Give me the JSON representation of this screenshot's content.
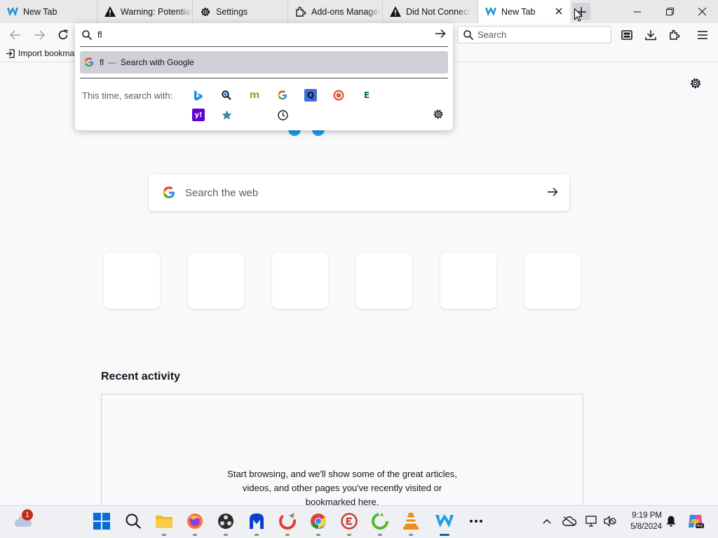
{
  "tabs": [
    {
      "title": "New Tab",
      "icon": "browser-w-icon"
    },
    {
      "title": "Warning: Potential",
      "icon": "warning-icon"
    },
    {
      "title": "Settings",
      "icon": "gear-icon"
    },
    {
      "title": "Add-ons Manager",
      "icon": "puzzle-icon"
    },
    {
      "title": "Did Not Connect",
      "icon": "warning-icon"
    },
    {
      "title": "New Tab",
      "icon": "browser-w-icon",
      "active": true
    }
  ],
  "toolbar": {
    "search_placeholder": "Search"
  },
  "bookmarks": {
    "import_label": "Import bookmarks..."
  },
  "urlbar": {
    "value": "fl",
    "result_query": "fl",
    "result_dash": "—",
    "result_action": "Search with Google",
    "engines_label": "This time, search with:",
    "engines": [
      "bing",
      "search-engine",
      "mojeek",
      "google",
      "qwant",
      "duckduckgo",
      "ecosia",
      "yahoo",
      "bookmarks",
      "history"
    ]
  },
  "page": {
    "search_placeholder": "Search the web",
    "recent_title": "Recent activity",
    "recent_empty_text": "Start browsing, and we'll show some of the great articles, videos, and other pages you've recently visited or bookmarked here."
  },
  "taskbar": {
    "weather_badge": "1",
    "time": "9:19 PM",
    "date": "5/8/2024"
  },
  "colors": {
    "accent": "#0067c0",
    "page_bg": "#f9f9fb",
    "tab_bg": "#e8e8ea",
    "highlight": "#cfcfd8"
  }
}
